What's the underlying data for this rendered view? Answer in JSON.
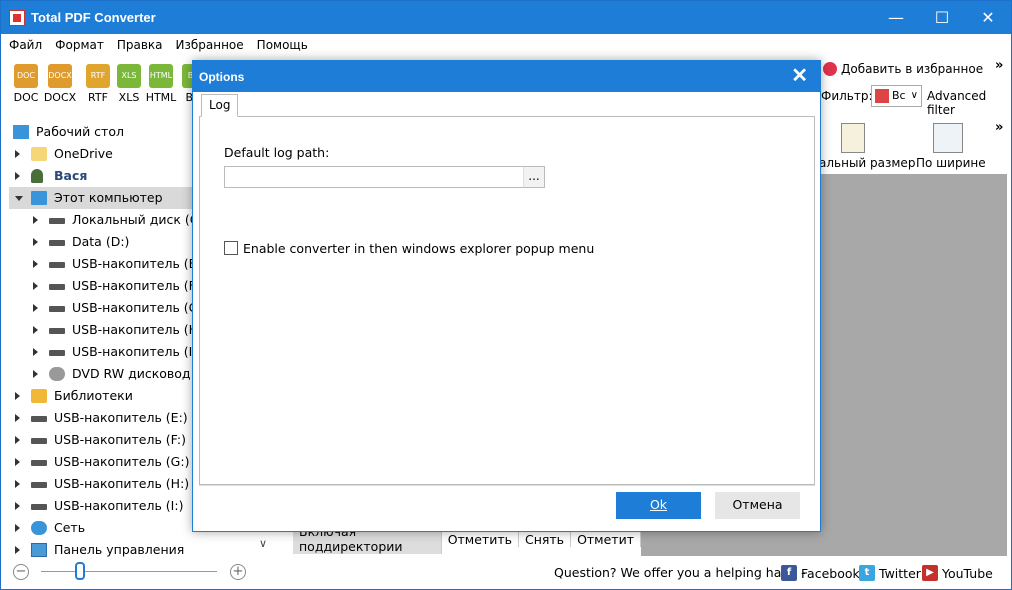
{
  "window": {
    "title": "Total PDF Converter",
    "controls": {
      "minimize": "—",
      "maximize": "☐",
      "close": "✕"
    }
  },
  "menu": [
    "Файл",
    "Формат",
    "Правка",
    "Избранное",
    "Помощь"
  ],
  "formats": [
    {
      "label": "DOC",
      "icon_text": "DOC",
      "color": "#e09b2d"
    },
    {
      "label": "DOCX",
      "icon_text": "DOCX",
      "color": "#e09b2d"
    },
    {
      "label": "RTF",
      "icon_text": "RTF",
      "color": "#e0a52d"
    },
    {
      "label": "XLS",
      "icon_text": "XLS",
      "color": "#7bb83a"
    },
    {
      "label": "HTML",
      "icon_text": "HTML",
      "color": "#7bb83a"
    },
    {
      "label": "BM",
      "icon_text": "BM",
      "color": "#7bb83a"
    }
  ],
  "tree": [
    {
      "label": "Рабочий стол",
      "icon": "desktop-icon",
      "level": 0,
      "arrow": "none"
    },
    {
      "label": "OneDrive",
      "icon": "folder-icon",
      "level": 1,
      "arrow": "right"
    },
    {
      "label": "Вася",
      "icon": "user-icon",
      "level": 1,
      "arrow": "right",
      "bold": true
    },
    {
      "label": "Этот компьютер",
      "icon": "computer-icon",
      "level": 1,
      "arrow": "down",
      "selected": true
    },
    {
      "label": "Локальный диск (C:)",
      "icon": "drive-icon",
      "level": 2,
      "arrow": "right"
    },
    {
      "label": "Data (D:)",
      "icon": "drive-icon",
      "level": 2,
      "arrow": "right"
    },
    {
      "label": "USB-накопитель (E:)",
      "icon": "drive-icon",
      "level": 2,
      "arrow": "right"
    },
    {
      "label": "USB-накопитель (F:)",
      "icon": "drive-icon",
      "level": 2,
      "arrow": "right"
    },
    {
      "label": "USB-накопитель (G:)",
      "icon": "drive-icon",
      "level": 2,
      "arrow": "right"
    },
    {
      "label": "USB-накопитель (H:)",
      "icon": "drive-icon",
      "level": 2,
      "arrow": "right"
    },
    {
      "label": "USB-накопитель (I:)",
      "icon": "drive-icon",
      "level": 2,
      "arrow": "right"
    },
    {
      "label": "DVD RW дисковод (J:)",
      "icon": "dvd-icon",
      "level": 2,
      "arrow": "right"
    },
    {
      "label": "Библиотеки",
      "icon": "library-icon",
      "level": 1,
      "arrow": "right"
    },
    {
      "label": "USB-накопитель (E:)",
      "icon": "drive-icon",
      "level": 1,
      "arrow": "right"
    },
    {
      "label": "USB-накопитель (F:)",
      "icon": "drive-icon",
      "level": 1,
      "arrow": "right"
    },
    {
      "label": "USB-накопитель (G:)",
      "icon": "drive-icon",
      "level": 1,
      "arrow": "right"
    },
    {
      "label": "USB-накопитель (H:)",
      "icon": "drive-icon",
      "level": 1,
      "arrow": "right"
    },
    {
      "label": "USB-накопитель (I:)",
      "icon": "drive-icon",
      "level": 1,
      "arrow": "right"
    },
    {
      "label": "Сеть",
      "icon": "network-icon",
      "level": 1,
      "arrow": "right"
    },
    {
      "label": "Панель управления",
      "icon": "control-panel-icon",
      "level": 1,
      "arrow": "right"
    }
  ],
  "right_toolbar": {
    "favorites_label": "Добавить в избранное",
    "filter_label": "Фильтр:",
    "filter_value": "Вс",
    "advanced_filter": "Advanced filter",
    "real_size_label": "альный размер",
    "fit_width_label": "По ширине",
    "more": "»"
  },
  "bottom_tabs": [
    "Включая поддиректории",
    "Отметить",
    "Снять",
    "Отметит"
  ],
  "status": {
    "zoom_minus": "−",
    "zoom_plus": "+",
    "zoom_level": 0.22,
    "help_text": "Question? We offer you a helping hand -",
    "facebook": "Facebook",
    "twitter": "Twitter",
    "youtube": "YouTube"
  },
  "dialog": {
    "title": "Options",
    "close": "✕",
    "tab": "Log",
    "log_path_label": "Default log path:",
    "log_path_value": "",
    "browse": "...",
    "explorer_checkbox_label": "Enable converter in then windows explorer popup menu",
    "explorer_checkbox_checked": false,
    "ok": "Ok",
    "cancel": "Отмена"
  }
}
